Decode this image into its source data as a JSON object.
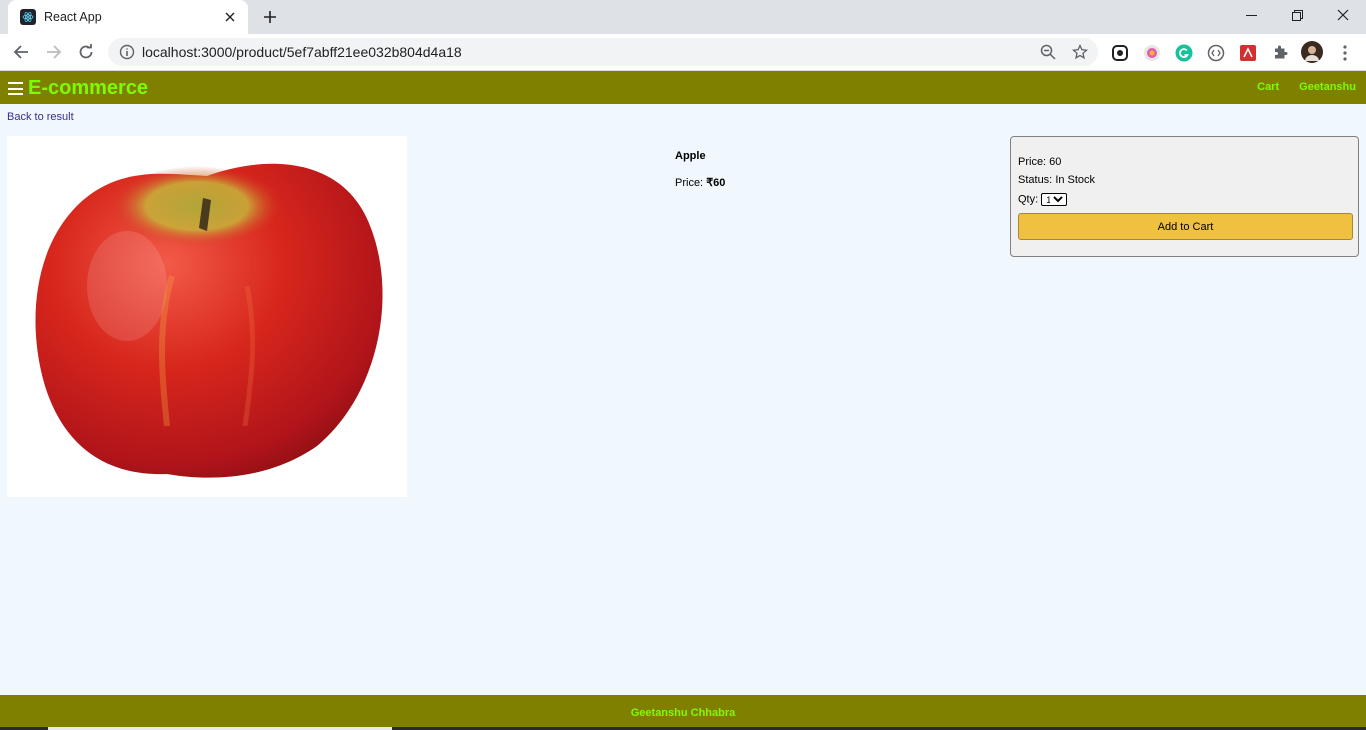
{
  "browser": {
    "tab_title": "React App",
    "url": "localhost:3000/product/5ef7abff21ee032b804d4a18"
  },
  "header": {
    "brand": "E-commerce",
    "cart_label": "Cart",
    "user_label": "Geetanshu"
  },
  "back_link": "Back to result",
  "product": {
    "name": "Apple",
    "price_label": "Price:",
    "price_value": "₹60",
    "image_alt": "apple-image"
  },
  "action": {
    "price_text": "Price: 60",
    "status_label": "Status:",
    "status_value": "In Stock",
    "qty_label": "Qty:",
    "qty_selected": "1",
    "qty_options": [
      "1"
    ],
    "add_button": "Add to Cart"
  },
  "footer": {
    "text": "Geetanshu Chhabra"
  },
  "colors": {
    "header_bg": "#808000",
    "brand_green": "#7cfc00",
    "page_bg": "#f0f7fd",
    "button_bg": "#f0c040"
  }
}
